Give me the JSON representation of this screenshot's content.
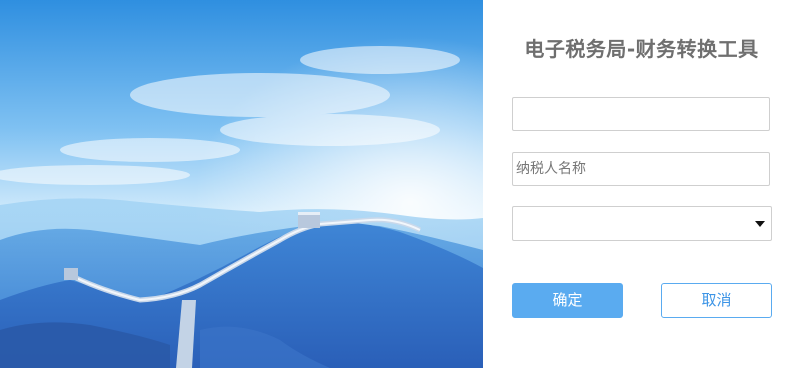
{
  "app": {
    "title": "电子税务局-财务转换工具"
  },
  "form": {
    "field1": {
      "value": "",
      "placeholder": ""
    },
    "taxpayer_name": {
      "value": "",
      "placeholder": "纳税人名称"
    },
    "select": {
      "selected": ""
    },
    "confirm_label": "确定",
    "cancel_label": "取消"
  },
  "hero": {
    "image": "great-wall-landscape"
  },
  "colors": {
    "accent": "#5aabf0",
    "title": "#6f6f6f",
    "border": "#cfcfcf"
  }
}
